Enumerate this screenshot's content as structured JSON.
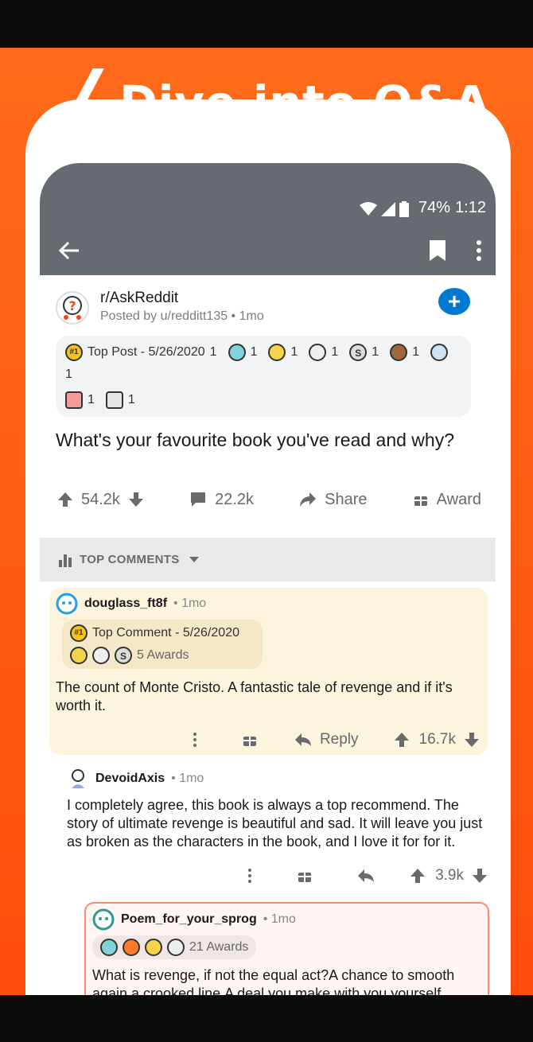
{
  "promo": {
    "headline": "Dive into Q&A"
  },
  "status": {
    "battery": "74%",
    "time": "1:12"
  },
  "post": {
    "subreddit": "r/AskReddit",
    "posted_by": "Posted by u/redditt135",
    "age": "1mo",
    "top_badge": "#1",
    "top_post_text": "Top Post - 5/26/2020",
    "award_counts_line1": [
      "1",
      "1",
      "1",
      "1",
      "1",
      "1",
      "1"
    ],
    "award_counts_line2": [
      "1",
      "1"
    ],
    "title": "What's your favourite book you've read and why?",
    "upvotes": "54.2k",
    "comments": "22.2k",
    "share_label": "Share",
    "award_label": "Award"
  },
  "sort": {
    "label": "TOP COMMENTS"
  },
  "comment1": {
    "user": "douglass_ft8f",
    "age": "1mo",
    "badge": "#1",
    "top_comment_text": "Top Comment - 5/26/2020",
    "awards_text": "5 Awards",
    "body": "The count of Monte Cristo. A fantastic tale of revenge and if it's worth it.",
    "reply_label": "Reply",
    "score": "16.7k"
  },
  "comment2": {
    "user": "DevoidAxis",
    "age": "1mo",
    "body": "I completely agree, this book is always a top recommend. The story of ultimate revenge is beautiful and sad. It will leave you just as broken as the characters in the book, and I love it for for it.",
    "score": "3.9k"
  },
  "comment3": {
    "user": "Poem_for_your_sprog",
    "age": "1mo",
    "awards_text": "21 Awards",
    "body": "What is revenge, if not the equal act?A chance to smooth again a crooked line.A deal you make with you yourself,"
  },
  "colors": {
    "brand_orange": "#ff5a14",
    "reddit_blue": "#0079d3",
    "appbar_gray": "#656b70"
  }
}
